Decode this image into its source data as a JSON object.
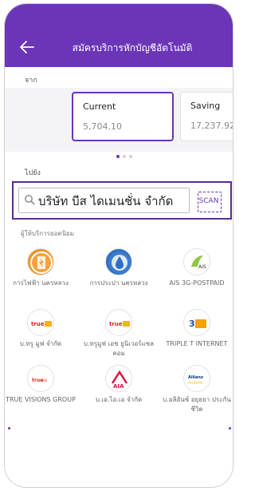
{
  "header": {
    "title": "สมัครบริการหักบัญชีอัตโนมัติ",
    "back_icon": "back-arrow-icon"
  },
  "from_section": {
    "label": "จาก",
    "accounts": [
      {
        "name": "Current",
        "balance": "5,704.10",
        "selected": true
      },
      {
        "name": "Saving",
        "balance": "17,237.92",
        "selected": false
      }
    ],
    "page_dots": 3,
    "active_dot": 0
  },
  "to_section": {
    "label": "ไปยัง",
    "search_value": "บริษัท บีส ไดเมนชั่น จำกัด",
    "scan_label": "SCAN"
  },
  "billers": {
    "label": "ผู้ให้บริการยอดนิยม",
    "items": [
      {
        "name": "การไฟฟ้า นครหลวง",
        "icon": "mea-logo-icon"
      },
      {
        "name": "การประปา นครหลวง",
        "icon": "mwa-logo-icon"
      },
      {
        "name": "AIS 3G-POSTPAID",
        "icon": "ais-logo-icon"
      },
      {
        "name": "บ.ทรู มูฟ จำกัด",
        "icon": "truemove-logo-icon"
      },
      {
        "name": "บ.ทรูมูฟ เอช ยูนิเวอร์แซล คอม",
        "icon": "truemove-h-logo-icon"
      },
      {
        "name": "TRIPLE T INTERNET",
        "icon": "3bb-logo-icon"
      },
      {
        "name": "TRUE VISIONS GROUP",
        "icon": "truevisions-logo-icon"
      },
      {
        "name": "บ.เอ.ไอ.เอ จำกัด",
        "icon": "aia-logo-icon"
      },
      {
        "name": "บ.อลิอันซ์ อยุธยา ประกันชีวิต",
        "icon": "allianz-ayudhya-logo-icon"
      }
    ]
  },
  "colors": {
    "primary": "#6b35b7",
    "search_border": "#5b2c8e"
  }
}
